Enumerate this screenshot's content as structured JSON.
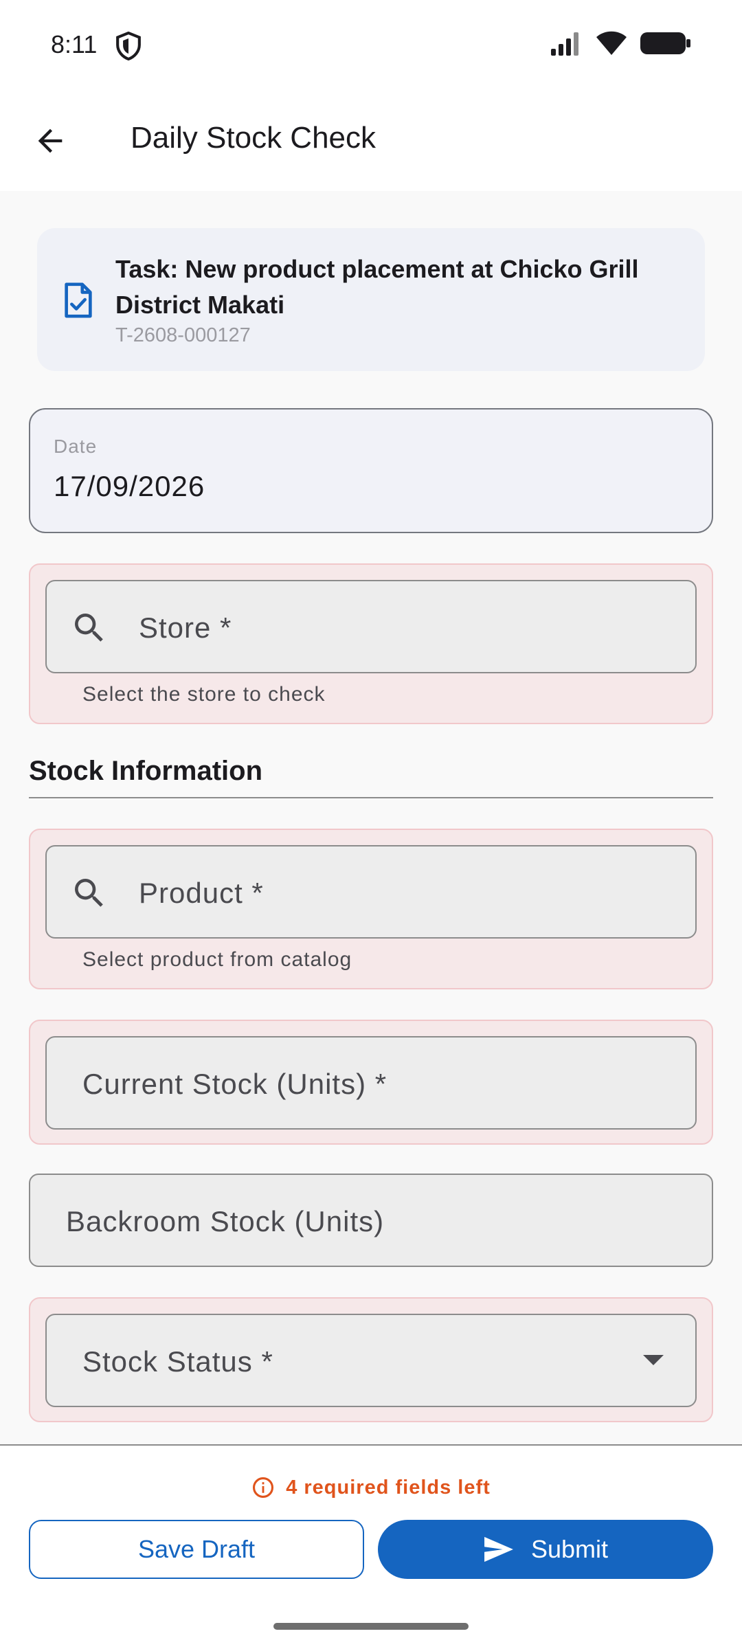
{
  "status_bar": {
    "time": "8:11"
  },
  "app_bar": {
    "title": "Daily Stock Check"
  },
  "task": {
    "title": "Task: New product placement at Chicko Grill District Makati",
    "id": "T-2608-000127"
  },
  "date_field": {
    "label": "Date",
    "value": "17/09/2026"
  },
  "store_field": {
    "placeholder": "Store *",
    "helper": "Select the store to check"
  },
  "section": {
    "title": "Stock Information"
  },
  "product_field": {
    "placeholder": "Product *",
    "helper": "Select product from catalog"
  },
  "current_stock_field": {
    "placeholder": "Current Stock (Units) *"
  },
  "backroom_stock_field": {
    "placeholder": "Backroom Stock (Units)"
  },
  "stock_status_field": {
    "placeholder": "Stock Status *"
  },
  "footer": {
    "required_note": "4 required fields left",
    "save_draft_label": "Save Draft",
    "submit_label": "Submit"
  },
  "colors": {
    "primary": "#1565c0",
    "error_bg": "#f6e8e9",
    "error_border": "#f1c7ca",
    "warning": "#e0541c"
  },
  "icons": [
    "shield-icon",
    "signal-icon",
    "wifi-icon",
    "battery-icon",
    "back-arrow-icon",
    "task-check-icon",
    "search-icon",
    "dropdown-arrow-icon",
    "info-icon",
    "send-icon"
  ]
}
